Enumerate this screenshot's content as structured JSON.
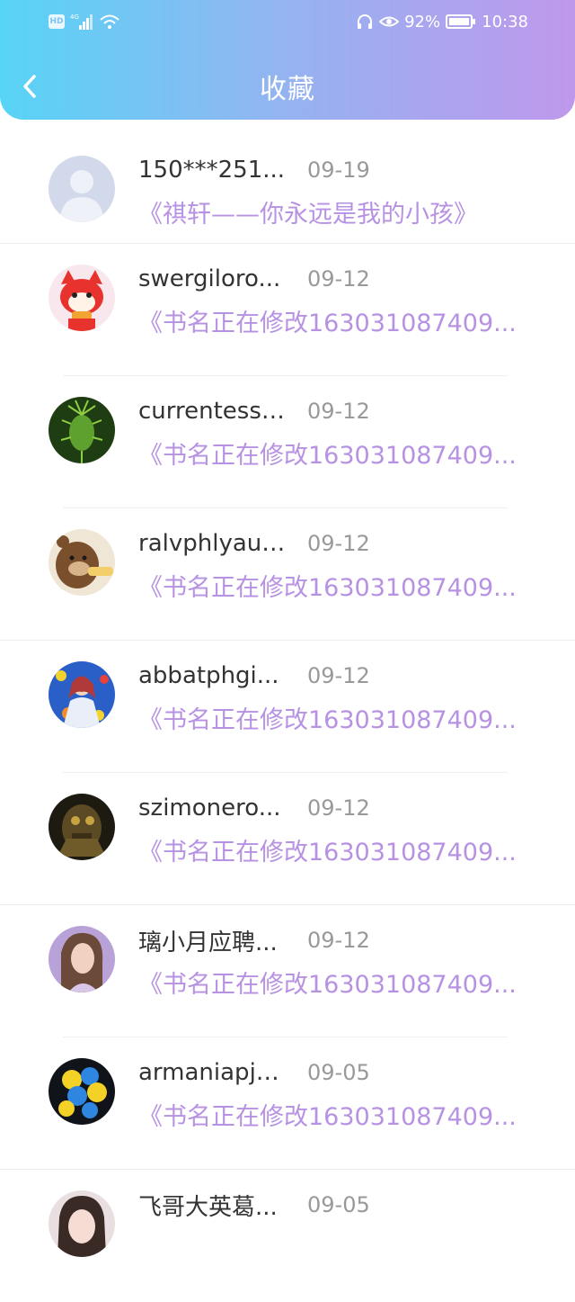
{
  "status_bar": {
    "hd": "HD",
    "network": "4G",
    "battery_percent": "92%",
    "time": "10:38"
  },
  "nav": {
    "title": "收藏",
    "back_icon": "chevron-left-icon"
  },
  "items": [
    {
      "name": "150***251...",
      "date": "09-19",
      "book": "《祺轩——你永远是我的小孩》",
      "avatar": "default-person",
      "divider": "full"
    },
    {
      "name": "swergiloro...",
      "date": "09-12",
      "book": "《书名正在修改163031087409...",
      "avatar": "red-cartoon-fox",
      "divider": "short"
    },
    {
      "name": "currentessl...",
      "date": "09-12",
      "book": "《书名正在修改163031087409...",
      "avatar": "green-plant",
      "divider": "short"
    },
    {
      "name": "ralvphlyaur...",
      "date": "09-12",
      "book": "《书名正在修改163031087409...",
      "avatar": "cartoon-bear",
      "divider": "full"
    },
    {
      "name": "abbatphgi...",
      "date": "09-12",
      "book": "《书名正在修改163031087409...",
      "avatar": "anime-girl-flowers",
      "divider": "short"
    },
    {
      "name": "szimonero...",
      "date": "09-12",
      "book": "《书名正在修改163031087409...",
      "avatar": "dark-robot",
      "divider": "full"
    },
    {
      "name": "璃小月应聘...",
      "date": "09-12",
      "book": "《书名正在修改163031087409...",
      "avatar": "painted-woman",
      "divider": "short"
    },
    {
      "name": "armaniapje...",
      "date": "09-05",
      "book": "《书名正在修改163031087409...",
      "avatar": "balloons",
      "divider": "full"
    },
    {
      "name": "飞哥大英葛...",
      "date": "09-05",
      "book": "",
      "avatar": "girl-photo",
      "divider": "none"
    }
  ]
}
